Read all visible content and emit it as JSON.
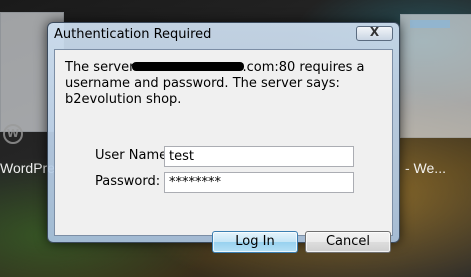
{
  "background": {
    "left_caption": "WordPre",
    "right_caption": "- We...",
    "wordpress_glyph": "W"
  },
  "dialog": {
    "title": "Authentication Required",
    "close_glyph": "X",
    "message_part1": "The server",
    "message_part2": ".com:80 requires a username and password. The server says: b2evolution shop.",
    "username_label": "User Name:",
    "username_value": "test",
    "password_label": "Password:",
    "password_value": "********",
    "login_label": "Log In",
    "cancel_label": "Cancel"
  },
  "icons": {
    "close": "close-icon",
    "wordpress": "wordpress-icon"
  },
  "colors": {
    "title_bar": "#c4d8ee",
    "login_button_border": "#3c7fb1",
    "redaction": "#000000"
  }
}
